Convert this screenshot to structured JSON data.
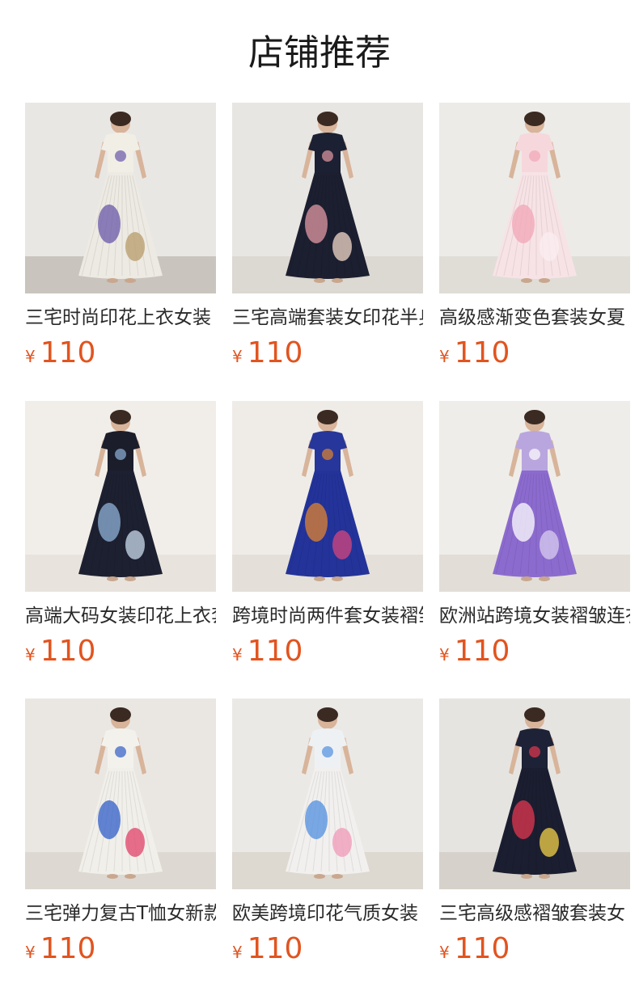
{
  "section": {
    "title": "店铺推荐"
  },
  "currency_symbol": "¥",
  "products": [
    {
      "name": "三宅时尚印花上衣女装",
      "price": "110",
      "palette": {
        "bg": "#e9e7e4",
        "floor": "#c9c4bd",
        "top": "#f1eee6",
        "skirt": "#eceae2",
        "accent": "#6a57a8",
        "accent2": "#b89b6a"
      }
    },
    {
      "name": "三宅高端套装女印花半身裙",
      "price": "110",
      "palette": {
        "bg": "#e8e6e2",
        "floor": "#dcd8d2",
        "top": "#1c2033",
        "skirt": "#1c1f30",
        "accent": "#e29aa4",
        "accent2": "#f3d9c9"
      }
    },
    {
      "name": "高级感渐变色套装女夏",
      "price": "110",
      "palette": {
        "bg": "#ecebe8",
        "floor": "#e0ddd7",
        "top": "#f6d8dc",
        "skirt": "#f7e3e6",
        "accent": "#f2a6b6",
        "accent2": "#fbeef0"
      }
    },
    {
      "name": "高端大码女装印花上衣套装",
      "price": "110",
      "palette": {
        "bg": "#f1eeea",
        "floor": "#e8e4dd",
        "top": "#1b1d2a",
        "skirt": "#1d2030",
        "accent": "#8fb2d8",
        "accent2": "#c9dbee"
      }
    },
    {
      "name": "跨境时尚两件套女装褶皱",
      "price": "110",
      "palette": {
        "bg": "#efece8",
        "floor": "#e4e0d9",
        "top": "#27369a",
        "skirt": "#23339a",
        "accent": "#e0842f",
        "accent2": "#d6467c"
      }
    },
    {
      "name": "欧洲站跨境女装褶皱连衣裙",
      "price": "110",
      "palette": {
        "bg": "#efede9",
        "floor": "#e2ded7",
        "top": "#b9a6de",
        "skirt": "#8c6bcf",
        "accent": "#ffffff",
        "accent2": "#d8ccef"
      }
    },
    {
      "name": "三宅弹力复古T恤女新款",
      "price": "110",
      "palette": {
        "bg": "#eae7e3",
        "floor": "#ddd9d2",
        "top": "#f3f1ec",
        "skirt": "#f1efe9",
        "accent": "#2f5dc8",
        "accent2": "#e0416a"
      }
    },
    {
      "name": "欧美跨境印花气质女装",
      "price": "110",
      "palette": {
        "bg": "#ebe9e6",
        "floor": "#ddd8d0",
        "top": "#eef1f4",
        "skirt": "#f2f0ee",
        "accent": "#4f8fe0",
        "accent2": "#f09ab8"
      }
    },
    {
      "name": "三宅高级感褶皱套装女",
      "price": "110",
      "palette": {
        "bg": "#e6e4e1",
        "floor": "#d6d2cb",
        "top": "#1e2236",
        "skirt": "#1b1e30",
        "accent": "#e2374f",
        "accent2": "#f3d24a"
      }
    }
  ]
}
